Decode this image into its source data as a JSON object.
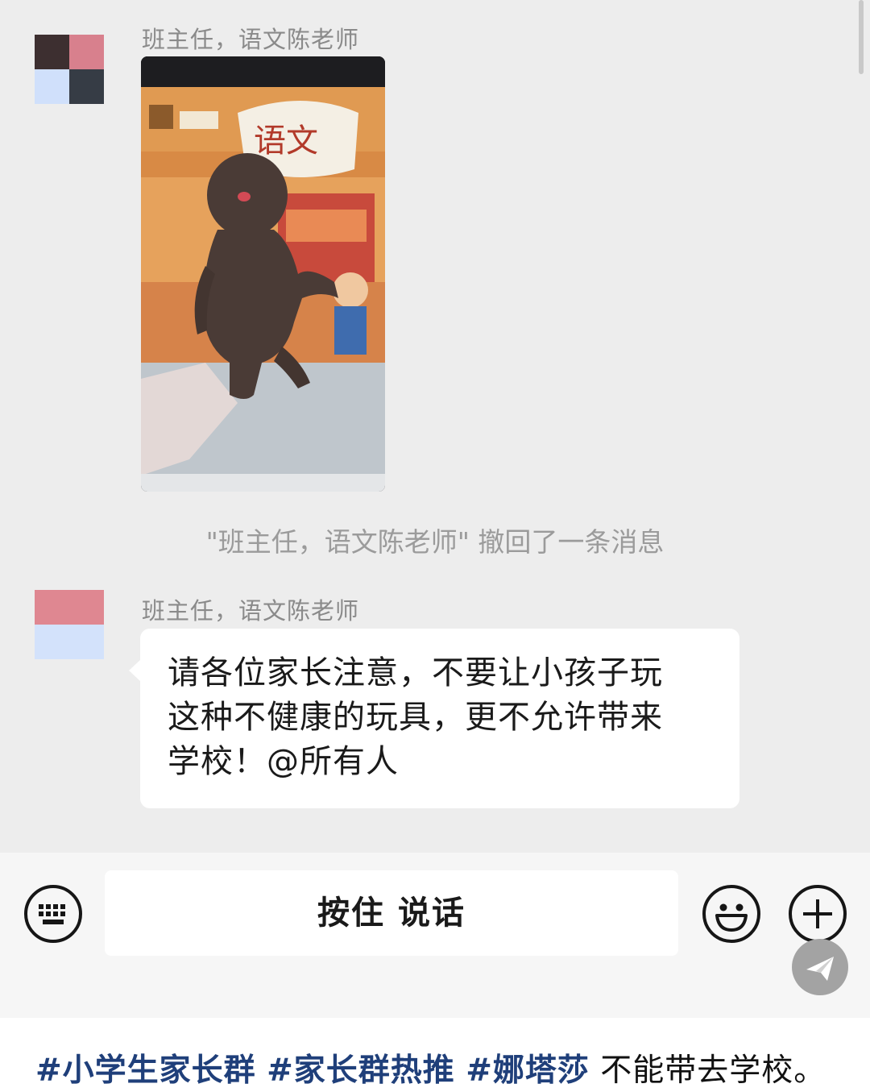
{
  "chat": {
    "message1": {
      "sender": "班主任，语文陈老师",
      "image_alt": "textbook photo"
    },
    "recall_notice": "\"班主任，语文陈老师\" 撤回了一条消息",
    "message2": {
      "sender": "班主任，语文陈老师",
      "lines": [
        "请各位家长注意，不要让小孩子玩",
        "这种不健康的玩具，更不允许带来",
        "学校！@所有人"
      ]
    }
  },
  "input_bar": {
    "keyboard_icon": "keyboard-icon",
    "talk_label": "按住 说话",
    "emoji_icon": "smile-icon",
    "plus_icon": "plus-icon"
  },
  "floating_button_icon": "send-arrow-icon",
  "caption": {
    "tag1": "#小学生家长群",
    "tag2": "#家长群热推",
    "tag3": "#娜塔莎",
    "text": "不能带去学校。"
  },
  "colors": {
    "chat_background": "#ededed",
    "bubble": "#ffffff",
    "hashtag": "#1f3f7a",
    "system_text": "#9b9b9b"
  }
}
